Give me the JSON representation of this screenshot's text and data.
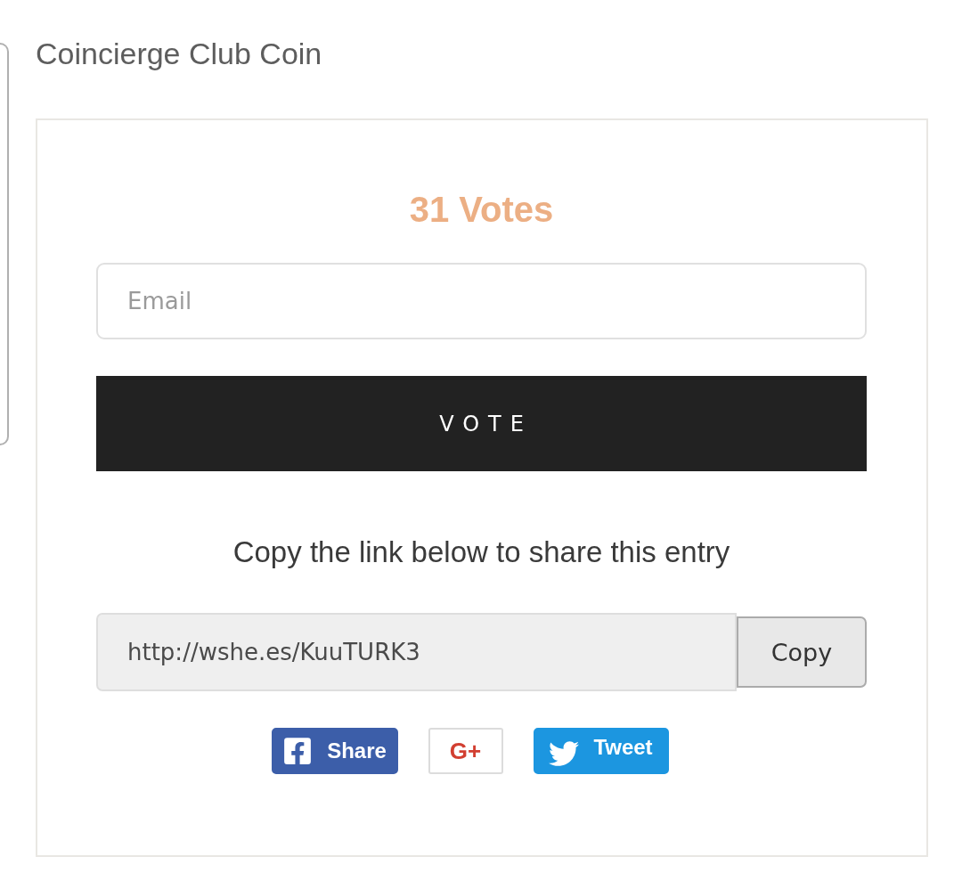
{
  "page": {
    "title": "Coincierge Club Coin"
  },
  "vote_card": {
    "votes": "31 Votes",
    "email_field": {
      "placeholder": "Email"
    },
    "vote_button": "VOTE",
    "share_prompt": "Copy the link below to share this entry",
    "share_link": {
      "value": "http://wshe.es/KuuTURK3",
      "copy_button": "Copy"
    },
    "social_buttons": [
      {
        "kind": "facebook",
        "label": "Share"
      },
      {
        "kind": "google_plus",
        "label": "G+"
      },
      {
        "kind": "twitter",
        "label": "Tweet"
      }
    ]
  }
}
